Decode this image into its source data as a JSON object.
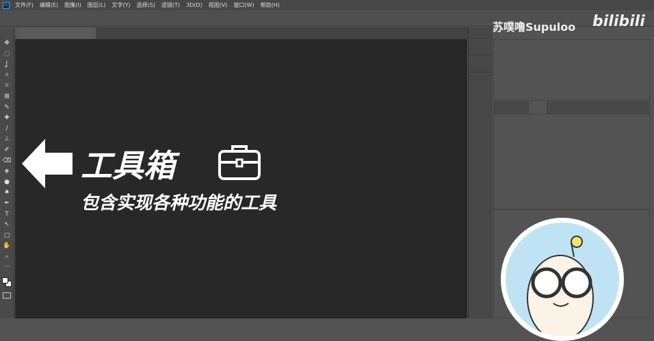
{
  "menu": [
    "文件(F)",
    "编辑(E)",
    "图像(I)",
    "图层(L)",
    "文字(Y)",
    "选择(S)",
    "滤镜(T)",
    "3D(D)",
    "视图(V)",
    "窗口(W)",
    "帮助(H)"
  ],
  "app_icon": "Ps",
  "tools": [
    "✥",
    "⬚",
    "ʆ",
    "✧",
    "⌗",
    "⊠",
    "✎",
    "✚",
    "/",
    "⊥",
    "✐",
    "⌫",
    "◈",
    "●",
    "♠",
    "✒",
    "T",
    "↖",
    "▢",
    "✋",
    "⌕",
    "···"
  ],
  "overlay": {
    "title": "工具箱",
    "subtitle": "包含实现各种功能的工具"
  },
  "watermark": {
    "author": "苏噗噜Supuloo",
    "site": "bilibili"
  }
}
